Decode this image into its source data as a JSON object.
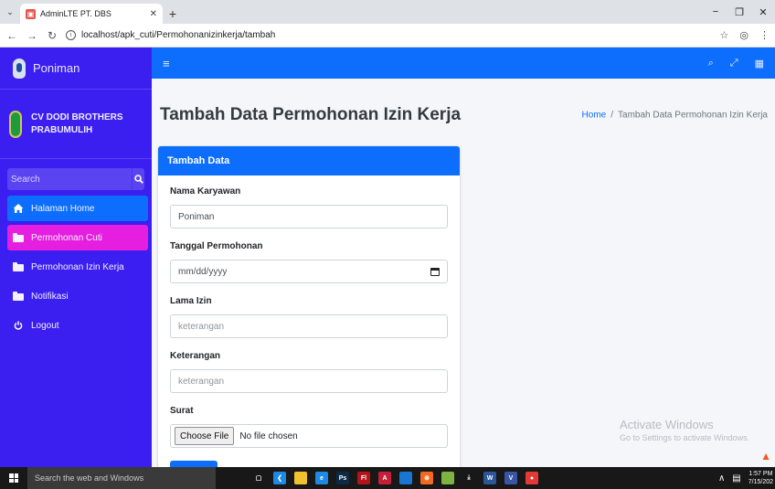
{
  "browser": {
    "tab_title": "AdminLTE PT. DBS",
    "tab_favicon": "adminlte-favicon",
    "new_tab_symbol": "+",
    "url": "localhost/apk_cuti/Permohonanizinkerja/tambah"
  },
  "brand": {
    "name": "Poniman"
  },
  "company": {
    "line1": "CV DODI BROTHERS",
    "line2": "PRABUMULIH"
  },
  "sidebar": {
    "search_placeholder": "Search",
    "items": [
      {
        "label": "Halaman Home",
        "icon": "home-icon",
        "state": "active"
      },
      {
        "label": "Permohonan Cuti",
        "icon": "folder-icon",
        "state": "highlight"
      },
      {
        "label": "Permohonan Izin Kerja",
        "icon": "folder-icon",
        "state": ""
      },
      {
        "label": "Notifikasi",
        "icon": "folder-icon",
        "state": ""
      },
      {
        "label": "Logout",
        "icon": "power-icon",
        "state": ""
      }
    ]
  },
  "page": {
    "title": "Tambah Data Permohonan Izin Kerja",
    "breadcrumb_home": "Home",
    "breadcrumb_sep": "/",
    "breadcrumb_current": "Tambah Data Permohonan Izin Kerja"
  },
  "card": {
    "header": "Tambah Data",
    "fields": {
      "nama_label": "Nama Karyawan",
      "nama_value": "Poniman",
      "tanggal_label": "Tanggal Permohonan",
      "tanggal_placeholder": "mm/dd/yyyy",
      "lama_label": "Lama Izin",
      "lama_placeholder": "keterangan",
      "keterangan_label": "Keterangan",
      "keterangan_placeholder": "keterangan",
      "surat_label": "Surat",
      "file_button": "Choose File",
      "file_status": "No file chosen"
    }
  },
  "watermark": {
    "title": "Activate Windows",
    "subtitle": "Go to Settings to activate Windows."
  },
  "taskbar": {
    "search_placeholder": "Search the web and Windows",
    "time": "1:57 PM",
    "date": "7/15/202",
    "apps": [
      {
        "name": "task-view-icon",
        "color": "#181818",
        "glyph": "▢"
      },
      {
        "name": "vscode-icon",
        "color": "#1e88e5",
        "glyph": "❮"
      },
      {
        "name": "file-explorer-icon",
        "color": "#f2c12e",
        "glyph": ""
      },
      {
        "name": "edge-icon",
        "color": "#1e88e5",
        "glyph": "e"
      },
      {
        "name": "photoshop-icon",
        "color": "#0b2a4a",
        "glyph": "Ps"
      },
      {
        "name": "flash-icon",
        "color": "#b3131a",
        "glyph": "Fl"
      },
      {
        "name": "acrobat-icon",
        "color": "#c41e3a",
        "glyph": "A"
      },
      {
        "name": "box-app-icon",
        "color": "#1976d2",
        "glyph": ""
      },
      {
        "name": "xampp-icon",
        "color": "#f26a22",
        "glyph": "⊗"
      },
      {
        "name": "game-icon",
        "color": "#7cb342",
        "glyph": ""
      },
      {
        "name": "download-icon",
        "color": "#181818",
        "glyph": "⤓"
      },
      {
        "name": "word-icon",
        "color": "#2b579a",
        "glyph": "W"
      },
      {
        "name": "visio-icon",
        "color": "#3955a3",
        "glyph": "V"
      },
      {
        "name": "chrome-icon",
        "color": "#e53935",
        "glyph": "●"
      }
    ]
  },
  "colors": {
    "sidebar": "#3b1ef0",
    "primary": "#0d6efd",
    "highlight": "#e51ee0"
  }
}
